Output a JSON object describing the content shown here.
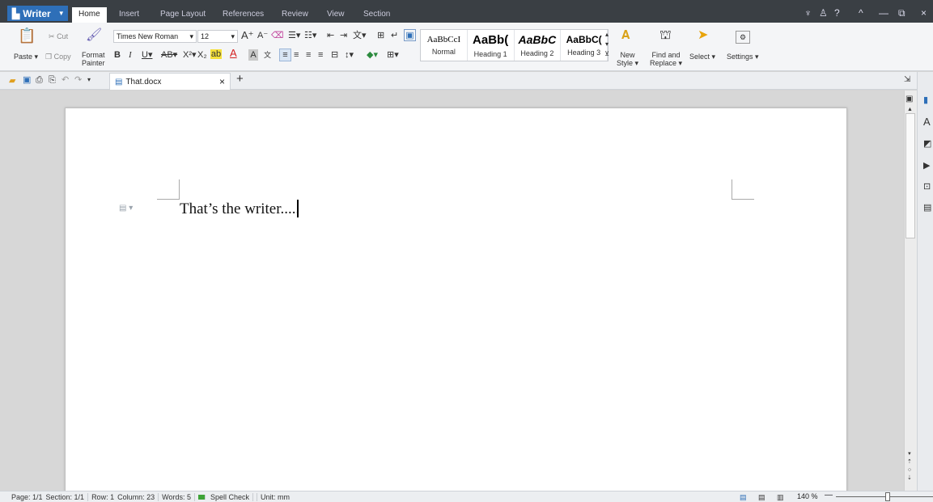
{
  "app": {
    "name": "Writer"
  },
  "menu_tabs": [
    "Home",
    "Insert",
    "Page Layout",
    "References",
    "Review",
    "View",
    "Section"
  ],
  "window_controls": {
    "skin": "♆",
    "user": "♙",
    "help": "?",
    "collapse": "^",
    "minimize": "—",
    "restore": "⧉",
    "close": "×"
  },
  "ribbon": {
    "paste": "Paste",
    "cut": "Cut",
    "copy": "Copy",
    "format_painter_1": "Format",
    "format_painter_2": "Painter",
    "font_name": "Times New Roman",
    "font_size": "12",
    "styles": [
      {
        "preview": "AaBbCcI",
        "name": "Normal"
      },
      {
        "preview": "AaBb(",
        "name": "Heading 1"
      },
      {
        "preview": "AaBbC",
        "name": "Heading 2"
      },
      {
        "preview": "AaBbC(",
        "name": "Heading 3"
      }
    ],
    "new_style_1": "New",
    "new_style_2": "Style",
    "find_replace_1": "Find and",
    "find_replace_2": "Replace",
    "select": "Select",
    "settings": "Settings"
  },
  "document": {
    "tab_title": "That.docx",
    "text": "That’s the writer....."
  },
  "status": {
    "page": "Page: 1/1",
    "section": "Section: 1/1",
    "row": "Row: 1",
    "column": "Column: 23",
    "words": "Words: 5",
    "spell": "Spell Check",
    "unit": "Unit: mm",
    "zoom": "140 %"
  },
  "colors": {
    "accent": "#2e6fb8",
    "topbar": "#3a3f44"
  }
}
